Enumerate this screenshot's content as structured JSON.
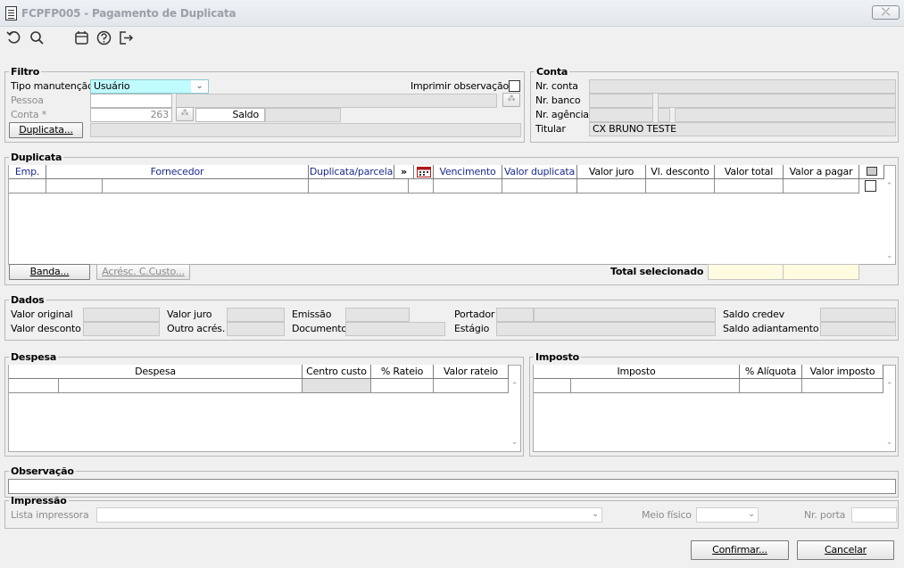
{
  "window": {
    "title": "FCPFP005 - Pagamento de Duplicata",
    "close_symbol": "⤫"
  },
  "toolbar": {
    "icons": [
      "undo-icon",
      "search-icon",
      "calendar-icon",
      "help-icon",
      "exit-icon"
    ]
  },
  "filtro": {
    "legend": "Filtro",
    "tipo_label": "Tipo manutenção",
    "tipo_value": "Usuário",
    "imprimir_label": "Imprimir observação",
    "pessoa_label": "Pessoa",
    "conta_label": "Conta *",
    "conta_value": "263",
    "saldo_label": "Saldo",
    "duplicata_button": "Duplicata..."
  },
  "conta": {
    "legend": "Conta",
    "nr_conta_label": "Nr. conta",
    "nr_banco_label": "Nr. banco",
    "nr_agencia_label": "Nr. agência",
    "titular_label": "Titular",
    "titular_value": "CX BRUNO TESTE"
  },
  "duplicata": {
    "legend": "Duplicata",
    "columns": [
      "Emp.",
      "Fornecedor",
      "Duplicata/parcela",
      "»",
      "",
      "Vencimento",
      "Valor duplicata",
      "Valor juro",
      "Vl. desconto",
      "Valor total",
      "Valor a pagar",
      ""
    ],
    "banda_button": "Banda...",
    "acresc_button": "Acrésc. C.Custo...",
    "total_label": "Total selecionado"
  },
  "dados": {
    "legend": "Dados",
    "valor_original": "Valor original",
    "valor_desconto": "Valor desconto",
    "valor_juro": "Valor juro",
    "outro_acres": "Outro acrés.",
    "emissao": "Emissão",
    "documento": "Documento",
    "portador": "Portador",
    "estagio": "Estágio",
    "saldo_credev": "Saldo credev",
    "saldo_adiantamento": "Saldo adiantamento"
  },
  "despesa": {
    "legend": "Despesa",
    "columns": [
      "Despesa",
      "Centro custo",
      "% Rateio",
      "Valor rateio"
    ]
  },
  "imposto": {
    "legend": "Imposto",
    "columns": [
      "Imposto",
      "% Alíquota",
      "Valor imposto"
    ]
  },
  "observacao": {
    "legend": "Observação"
  },
  "impressao": {
    "legend": "Impressão",
    "lista_label": "Lista impressora",
    "meio_label": "Meio físico",
    "porta_label": "Nr. porta"
  },
  "footer": {
    "confirmar": "Confirmar...",
    "cancelar": "Cancelar"
  },
  "colors": {
    "accent_field": "#c0fbff",
    "total_field": "#fffbe1",
    "header_blue": "#1a2b8c",
    "calendar_red": "#b01818"
  }
}
